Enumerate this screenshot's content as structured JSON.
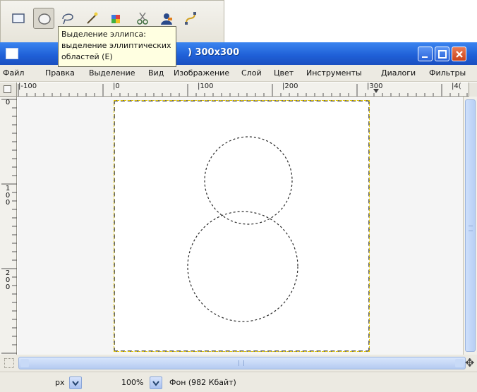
{
  "toolbox": {
    "tools": [
      {
        "icon": "rect-select-icon"
      },
      {
        "icon": "ellipse-select-icon"
      },
      {
        "icon": "lasso-select-icon"
      },
      {
        "icon": "magic-wand-icon"
      },
      {
        "icon": "color-select-icon"
      },
      {
        "icon": "scissors-select-icon"
      },
      {
        "icon": "foreground-select-icon"
      },
      {
        "icon": "paths-icon"
      }
    ]
  },
  "tooltip": {
    "line1": "Выделение эллипса:",
    "line2": "выделение эллиптических",
    "line3": "областей  (E)"
  },
  "window": {
    "title": ") 300x300"
  },
  "menu": [
    "Файл",
    "Правка",
    "Выделение",
    "Вид",
    "Изображение",
    "Слой",
    "Цвет",
    "Инструменты",
    "Диалоги",
    "Фильтры"
  ],
  "ruler_top": {
    "labels": [
      "|-100",
      "|0",
      "|100",
      "|200",
      "|300",
      "|4("
    ]
  },
  "ruler_left": {
    "labels": [
      "0",
      "100",
      "200"
    ]
  },
  "statusbar": {
    "unit": "px",
    "zoom": "100%",
    "status": "Фон (982 Кбайт)"
  },
  "colors": {
    "titlebar": "#2460d8",
    "tooltip_bg": "#ffffe1",
    "selection_yellow": "#e0c400"
  }
}
